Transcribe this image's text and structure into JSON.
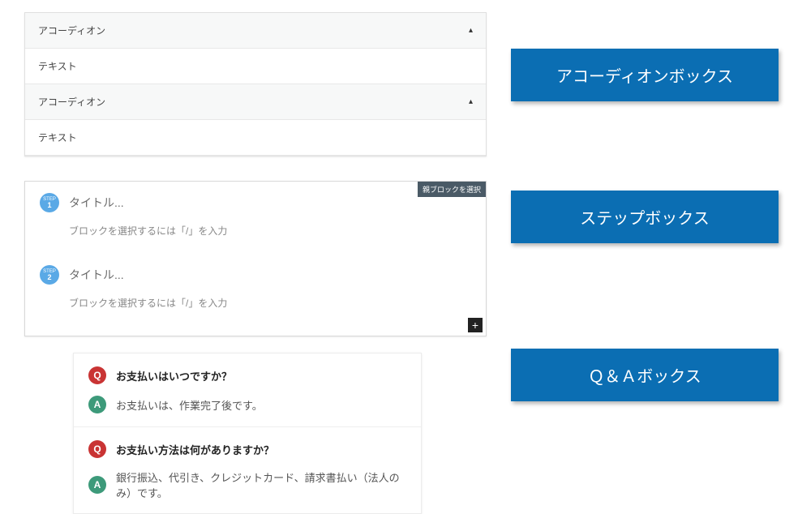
{
  "labels": {
    "accordion": "アコーディオンボックス",
    "step": "ステップボックス",
    "qa": "Ｑ＆Ａボックス"
  },
  "accordion": {
    "items": [
      {
        "header": "アコーディオン",
        "body": "テキスト"
      },
      {
        "header": "アコーディオン",
        "body": "テキスト"
      }
    ]
  },
  "step": {
    "tag": "親ブロックを選択",
    "badge_label": "STEP",
    "items": [
      {
        "num": "1",
        "title": "タイトル...",
        "hint": "ブロックを選択するには「/」を入力"
      },
      {
        "num": "2",
        "title": "タイトル...",
        "hint": "ブロックを選択するには「/」を入力"
      }
    ]
  },
  "qa": {
    "q_mark": "Q",
    "a_mark": "A",
    "items": [
      {
        "question": "お支払いはいつですか？",
        "answer": "お支払いは、作業完了後です。"
      },
      {
        "question": "お支払い方法は何がありますか？",
        "answer": "銀行振込、代引き、クレジットカード、請求書払い（法人のみ）です。"
      }
    ]
  }
}
